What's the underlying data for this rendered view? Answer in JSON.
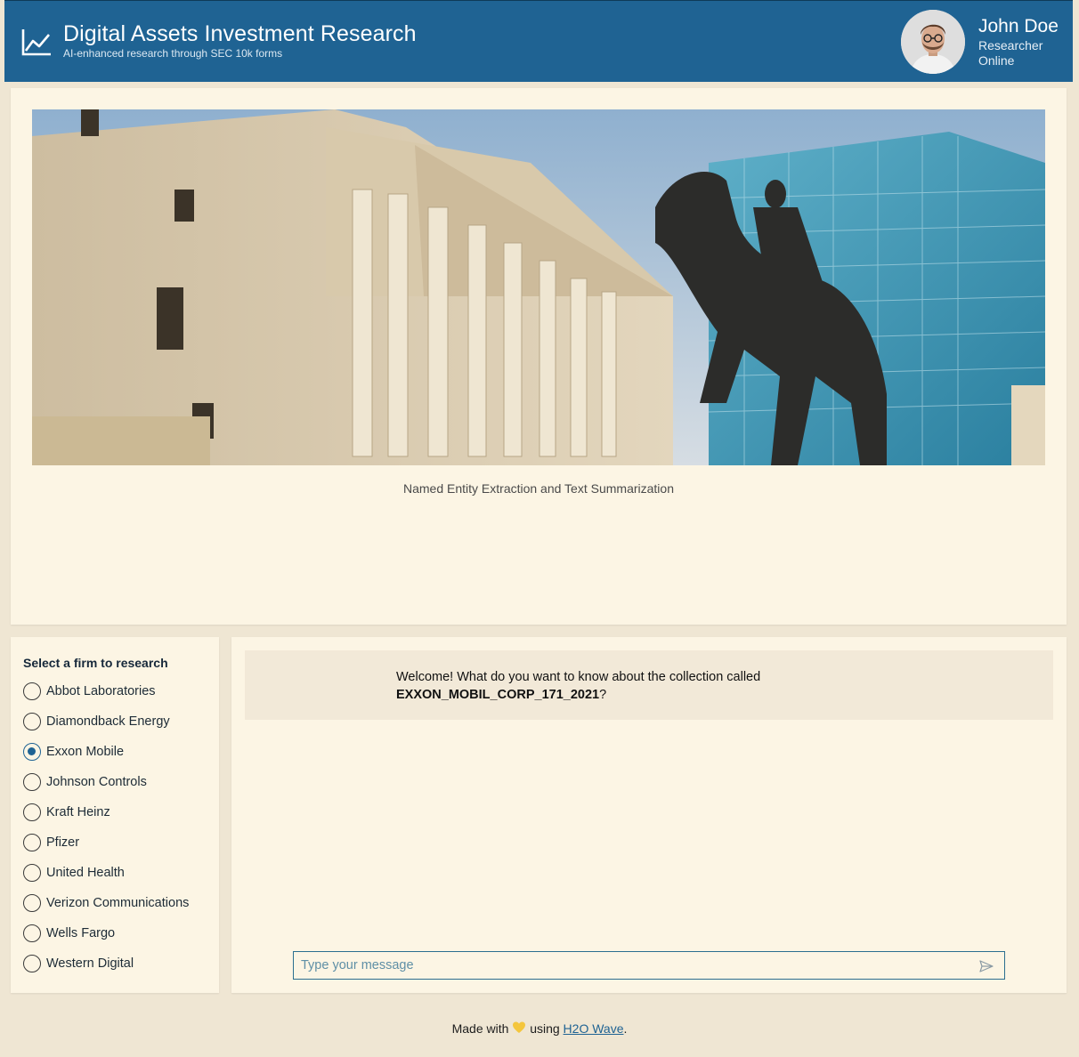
{
  "header": {
    "title": "Digital Assets Investment Research",
    "subtitle": "AI-enhanced research through SEC 10k forms",
    "logo_icon": "line-chart-icon",
    "background_color": "#1f6393",
    "user": {
      "name": "John Doe",
      "role": "Researcher",
      "status": "Online"
    }
  },
  "hero": {
    "caption": "Named Entity Extraction and Text Summarization",
    "image_subject": "bank-building-and-equestrian-statue"
  },
  "firm_selector": {
    "heading": "Select a firm to research",
    "selected": "Exxon Mobile",
    "options": [
      "Abbot Laboratories",
      "Diamondback Energy",
      "Exxon Mobile",
      "Johnson Controls",
      "Kraft Heinz",
      "Pfizer",
      "United Health",
      "Verizon Communications",
      "Wells Fargo",
      "Western Digital"
    ]
  },
  "chat": {
    "message_prefix": "Welcome! What do you want to know about the collection called",
    "collection_name": "EXXON_MOBIL_CORP_171_2021",
    "message_suffix": "?",
    "input_placeholder": "Type your message",
    "input_value": "",
    "send_icon": "send-icon"
  },
  "footer": {
    "prefix": "Made with",
    "heart_icon": "heart-icon",
    "middle": "using",
    "link_text": "H2O Wave",
    "suffix": "."
  },
  "colors": {
    "page_background": "#efe6d3",
    "card_background": "#fcf5e4",
    "accent": "#1f6393",
    "heart": "#f4c63d"
  }
}
